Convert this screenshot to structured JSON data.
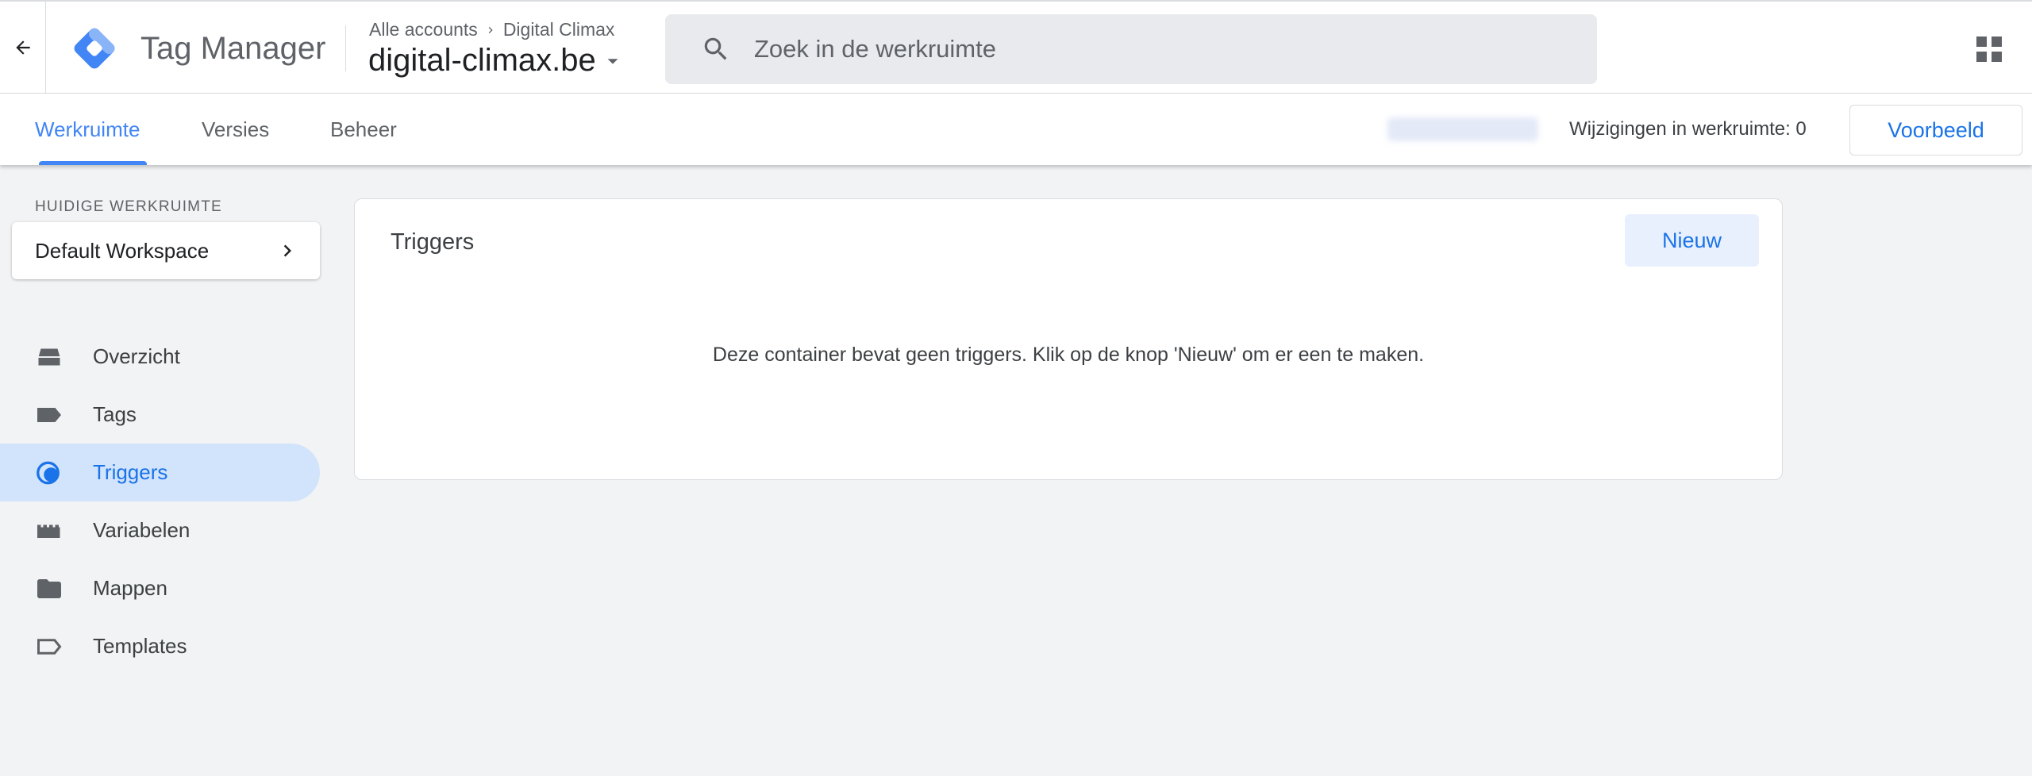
{
  "header": {
    "app_name": "Tag Manager",
    "breadcrumb": {
      "level1": "Alle accounts",
      "level2": "Digital Climax"
    },
    "container_name": "digital-climax.be",
    "search_placeholder": "Zoek in de werkruimte"
  },
  "tabs": [
    {
      "label": "Werkruimte",
      "active": true
    },
    {
      "label": "Versies",
      "active": false
    },
    {
      "label": "Beheer",
      "active": false
    }
  ],
  "status": {
    "changes_label": "Wijzigingen in werkruimte: 0",
    "preview_label": "Voorbeeld"
  },
  "sidebar": {
    "workspace_label": "HUIDIGE WERKRUIMTE",
    "workspace_name": "Default Workspace",
    "items": [
      {
        "label": "Overzicht",
        "icon": "overview-icon",
        "active": false
      },
      {
        "label": "Tags",
        "icon": "tag-icon",
        "active": false
      },
      {
        "label": "Triggers",
        "icon": "trigger-icon",
        "active": true
      },
      {
        "label": "Variabelen",
        "icon": "variables-icon",
        "active": false
      },
      {
        "label": "Mappen",
        "icon": "folder-icon",
        "active": false
      },
      {
        "label": "Templates",
        "icon": "template-icon",
        "active": false
      }
    ]
  },
  "main": {
    "title": "Triggers",
    "new_label": "Nieuw",
    "empty_message": "Deze container bevat geen triggers. Klik op de knop 'Nieuw' om er een te maken."
  },
  "colors": {
    "accent": "#1a73e8",
    "active_nav_bg": "#d2e3fc",
    "page_bg": "#f1f3f4"
  }
}
